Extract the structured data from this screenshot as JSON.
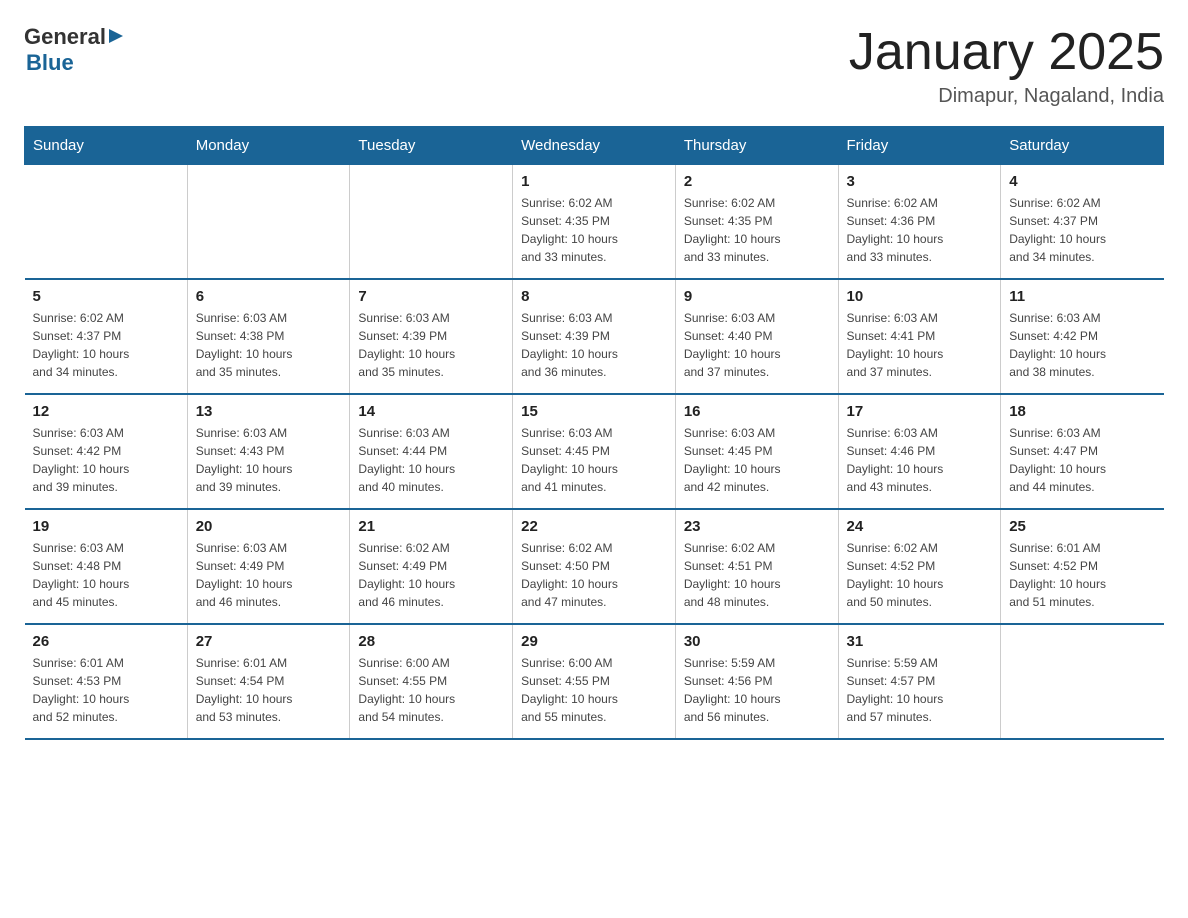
{
  "logo": {
    "general": "General",
    "blue": "Blue",
    "arrow": "▶"
  },
  "title": "January 2025",
  "subtitle": "Dimapur, Nagaland, India",
  "days_header": [
    "Sunday",
    "Monday",
    "Tuesday",
    "Wednesday",
    "Thursday",
    "Friday",
    "Saturday"
  ],
  "weeks": [
    [
      {
        "day": "",
        "info": ""
      },
      {
        "day": "",
        "info": ""
      },
      {
        "day": "",
        "info": ""
      },
      {
        "day": "1",
        "info": "Sunrise: 6:02 AM\nSunset: 4:35 PM\nDaylight: 10 hours\nand 33 minutes."
      },
      {
        "day": "2",
        "info": "Sunrise: 6:02 AM\nSunset: 4:35 PM\nDaylight: 10 hours\nand 33 minutes."
      },
      {
        "day": "3",
        "info": "Sunrise: 6:02 AM\nSunset: 4:36 PM\nDaylight: 10 hours\nand 33 minutes."
      },
      {
        "day": "4",
        "info": "Sunrise: 6:02 AM\nSunset: 4:37 PM\nDaylight: 10 hours\nand 34 minutes."
      }
    ],
    [
      {
        "day": "5",
        "info": "Sunrise: 6:02 AM\nSunset: 4:37 PM\nDaylight: 10 hours\nand 34 minutes."
      },
      {
        "day": "6",
        "info": "Sunrise: 6:03 AM\nSunset: 4:38 PM\nDaylight: 10 hours\nand 35 minutes."
      },
      {
        "day": "7",
        "info": "Sunrise: 6:03 AM\nSunset: 4:39 PM\nDaylight: 10 hours\nand 35 minutes."
      },
      {
        "day": "8",
        "info": "Sunrise: 6:03 AM\nSunset: 4:39 PM\nDaylight: 10 hours\nand 36 minutes."
      },
      {
        "day": "9",
        "info": "Sunrise: 6:03 AM\nSunset: 4:40 PM\nDaylight: 10 hours\nand 37 minutes."
      },
      {
        "day": "10",
        "info": "Sunrise: 6:03 AM\nSunset: 4:41 PM\nDaylight: 10 hours\nand 37 minutes."
      },
      {
        "day": "11",
        "info": "Sunrise: 6:03 AM\nSunset: 4:42 PM\nDaylight: 10 hours\nand 38 minutes."
      }
    ],
    [
      {
        "day": "12",
        "info": "Sunrise: 6:03 AM\nSunset: 4:42 PM\nDaylight: 10 hours\nand 39 minutes."
      },
      {
        "day": "13",
        "info": "Sunrise: 6:03 AM\nSunset: 4:43 PM\nDaylight: 10 hours\nand 39 minutes."
      },
      {
        "day": "14",
        "info": "Sunrise: 6:03 AM\nSunset: 4:44 PM\nDaylight: 10 hours\nand 40 minutes."
      },
      {
        "day": "15",
        "info": "Sunrise: 6:03 AM\nSunset: 4:45 PM\nDaylight: 10 hours\nand 41 minutes."
      },
      {
        "day": "16",
        "info": "Sunrise: 6:03 AM\nSunset: 4:45 PM\nDaylight: 10 hours\nand 42 minutes."
      },
      {
        "day": "17",
        "info": "Sunrise: 6:03 AM\nSunset: 4:46 PM\nDaylight: 10 hours\nand 43 minutes."
      },
      {
        "day": "18",
        "info": "Sunrise: 6:03 AM\nSunset: 4:47 PM\nDaylight: 10 hours\nand 44 minutes."
      }
    ],
    [
      {
        "day": "19",
        "info": "Sunrise: 6:03 AM\nSunset: 4:48 PM\nDaylight: 10 hours\nand 45 minutes."
      },
      {
        "day": "20",
        "info": "Sunrise: 6:03 AM\nSunset: 4:49 PM\nDaylight: 10 hours\nand 46 minutes."
      },
      {
        "day": "21",
        "info": "Sunrise: 6:02 AM\nSunset: 4:49 PM\nDaylight: 10 hours\nand 46 minutes."
      },
      {
        "day": "22",
        "info": "Sunrise: 6:02 AM\nSunset: 4:50 PM\nDaylight: 10 hours\nand 47 minutes."
      },
      {
        "day": "23",
        "info": "Sunrise: 6:02 AM\nSunset: 4:51 PM\nDaylight: 10 hours\nand 48 minutes."
      },
      {
        "day": "24",
        "info": "Sunrise: 6:02 AM\nSunset: 4:52 PM\nDaylight: 10 hours\nand 50 minutes."
      },
      {
        "day": "25",
        "info": "Sunrise: 6:01 AM\nSunset: 4:52 PM\nDaylight: 10 hours\nand 51 minutes."
      }
    ],
    [
      {
        "day": "26",
        "info": "Sunrise: 6:01 AM\nSunset: 4:53 PM\nDaylight: 10 hours\nand 52 minutes."
      },
      {
        "day": "27",
        "info": "Sunrise: 6:01 AM\nSunset: 4:54 PM\nDaylight: 10 hours\nand 53 minutes."
      },
      {
        "day": "28",
        "info": "Sunrise: 6:00 AM\nSunset: 4:55 PM\nDaylight: 10 hours\nand 54 minutes."
      },
      {
        "day": "29",
        "info": "Sunrise: 6:00 AM\nSunset: 4:55 PM\nDaylight: 10 hours\nand 55 minutes."
      },
      {
        "day": "30",
        "info": "Sunrise: 5:59 AM\nSunset: 4:56 PM\nDaylight: 10 hours\nand 56 minutes."
      },
      {
        "day": "31",
        "info": "Sunrise: 5:59 AM\nSunset: 4:57 PM\nDaylight: 10 hours\nand 57 minutes."
      },
      {
        "day": "",
        "info": ""
      }
    ]
  ]
}
